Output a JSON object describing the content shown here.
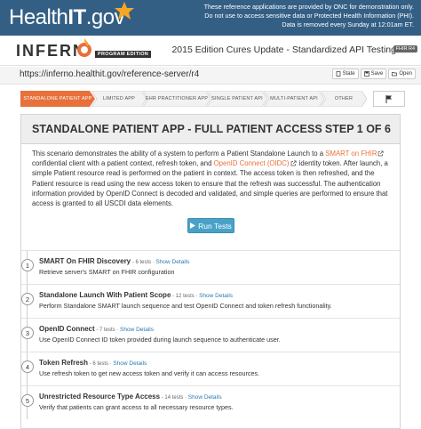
{
  "banner": {
    "brand_health": "Health",
    "brand_it": "IT",
    "brand_gov": ".gov",
    "disclaimer_lines": [
      "These reference applications are provided by ONC for demonstration only.",
      "Do not use to access sensitive data or Protected Health Information (PHI).",
      "Data is removed every Sunday at 12:01am ET."
    ]
  },
  "header": {
    "logo_text": "INFERN",
    "program_badge": "PROGRAM EDITION",
    "title": "2015 Edition Cures Update - Standardized API Testing",
    "fhir_badge": "FHIR R4"
  },
  "urlbar": {
    "url": "https://inferno.healthit.gov/reference-server/r4",
    "state_label": "State",
    "save_label": "Save",
    "open_label": "Open"
  },
  "steps": [
    {
      "label": "Standalone Patient App",
      "active": true
    },
    {
      "label": "Limited App",
      "active": false
    },
    {
      "label": "EHR Practitioner App",
      "active": false
    },
    {
      "label": "Single Patient API",
      "active": false
    },
    {
      "label": "Multi-Patient API",
      "active": false
    },
    {
      "label": "Other",
      "active": false
    }
  ],
  "card": {
    "title": "STANDALONE PATIENT APP - FULL PATIENT ACCESS",
    "step": "STEP 1 OF 6",
    "desc_1": "This scenario demonstrates the ability of a system to perform a Patient Standalone Launch to a ",
    "desc_link_1": "SMART on FHIR",
    "desc_2": "confidential client with a patient context, refresh token, and ",
    "desc_link_2": "OpenID Connect (OIDC)",
    "desc_3": " identity token. After launch, a simple Patient resource read is performed on the patient in context. The access token is then refreshed, and the Patient resource is read using the new access token to ensure that the refresh was successful. The authentication information provided by OpenID Connect is decoded and validated, and simple queries are performed to ensure that access is granted to all USCDI data elements.",
    "run_label": "Run Tests"
  },
  "tests": [
    {
      "num": "1",
      "name": "SMART On FHIR Discovery",
      "count": " - 6 tests · ",
      "show": "Show Details",
      "desc": "Retrieve server's SMART on FHIR configuration"
    },
    {
      "num": "2",
      "name": "Standalone Launch With Patient Scope",
      "count": " - 12 tests · ",
      "show": "Show Details",
      "desc": "Perform Standalone SMART launch sequence and test OpenID Connect and token refresh functionality."
    },
    {
      "num": "3",
      "name": "OpenID Connect",
      "count": " - 7 tests · ",
      "show": "Show Details",
      "desc": "Use OpenID Connect ID token provided during launch sequence to authenticate user."
    },
    {
      "num": "4",
      "name": "Token Refresh",
      "count": " - 6 tests · ",
      "show": "Show Details",
      "desc": "Use refresh token to get new access token and verify it can access resources."
    },
    {
      "num": "5",
      "name": "Unrestricted Resource Type Access",
      "count": " - 14 tests · ",
      "show": "Show Details",
      "desc": "Verify that patients can grant access to all necessary resource types."
    }
  ],
  "colors": {
    "banner_bg": "#345f85",
    "accent_orange": "#e8703a",
    "run_button": "#48a2c7",
    "link_blue": "#2a7ab0"
  }
}
